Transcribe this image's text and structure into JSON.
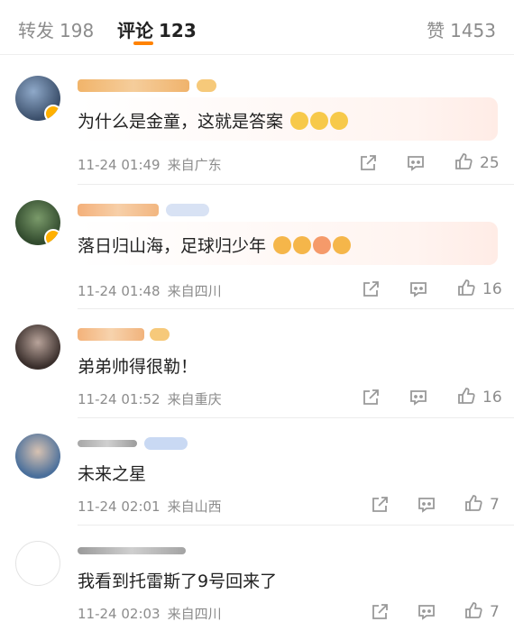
{
  "tabs": {
    "repost": {
      "label": "转发",
      "count": "198"
    },
    "comment": {
      "label": "评论",
      "count": "123"
    },
    "like": {
      "label": "赞",
      "count": "1453"
    }
  },
  "colors": {
    "accent": "#ff8200",
    "muted": "#8c8c8c",
    "text": "#222222"
  },
  "comments": [
    {
      "text": "为什么是金童，这就是答案",
      "time": "11-24 01:49",
      "location": "来自广东",
      "likes": "25"
    },
    {
      "text": "落日归山海，足球归少年",
      "time": "11-24 01:48",
      "location": "来自四川",
      "likes": "16"
    },
    {
      "text": "弟弟帅得很勒！",
      "time": "11-24 01:52",
      "location": "来自重庆",
      "likes": "16"
    },
    {
      "text": "未来之星",
      "time": "11-24 02:01",
      "location": "来自山西",
      "likes": "7"
    },
    {
      "text": "我看到托雷斯了9号回来了",
      "time": "11-24 02:03",
      "location": "来自四川",
      "likes": "7"
    }
  ],
  "icons": {
    "share": "share-icon",
    "reply": "comment-icon",
    "like": "thumbs-up-icon"
  }
}
